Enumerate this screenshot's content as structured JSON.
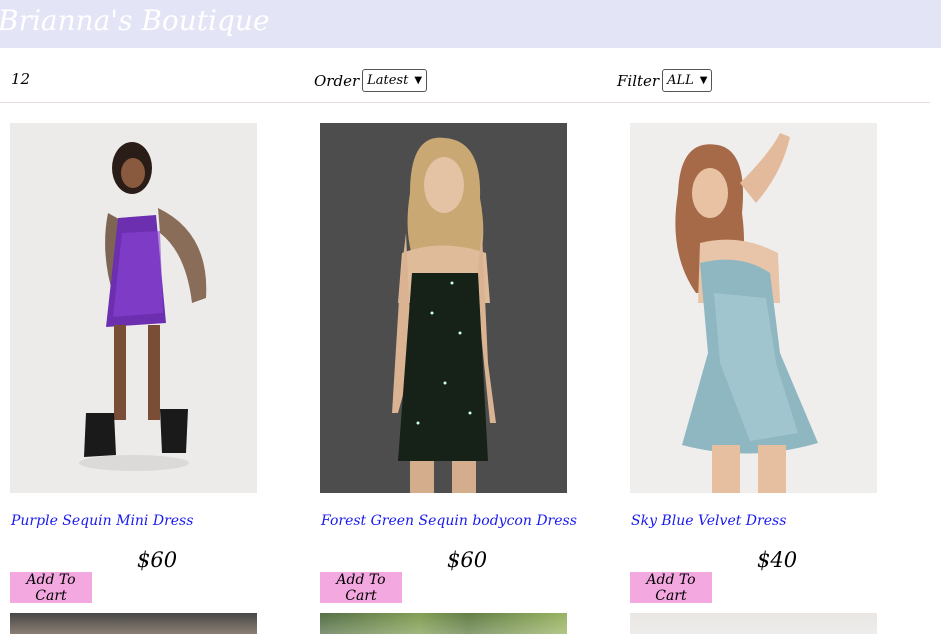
{
  "header": {
    "brand": "Brianna's Boutique"
  },
  "toolbar": {
    "count": "12",
    "order_label": "Order",
    "order_value": "Latest",
    "filter_label": "Filter",
    "filter_value": "ALL"
  },
  "products": [
    {
      "name": "Purple Sequin Mini Dress",
      "price": "$60",
      "cart_label": "Add To Cart"
    },
    {
      "name": "Forest Green Sequin bodycon Dress",
      "price": "$60",
      "cart_label": "Add To Cart"
    },
    {
      "name": "Sky Blue Velvet Dress",
      "price": "$40",
      "cart_label": "Add To Cart"
    }
  ],
  "colors": {
    "header_bg": "#e4e4f7",
    "link": "#1a1aee",
    "cart_button": "#f3a8e0"
  }
}
